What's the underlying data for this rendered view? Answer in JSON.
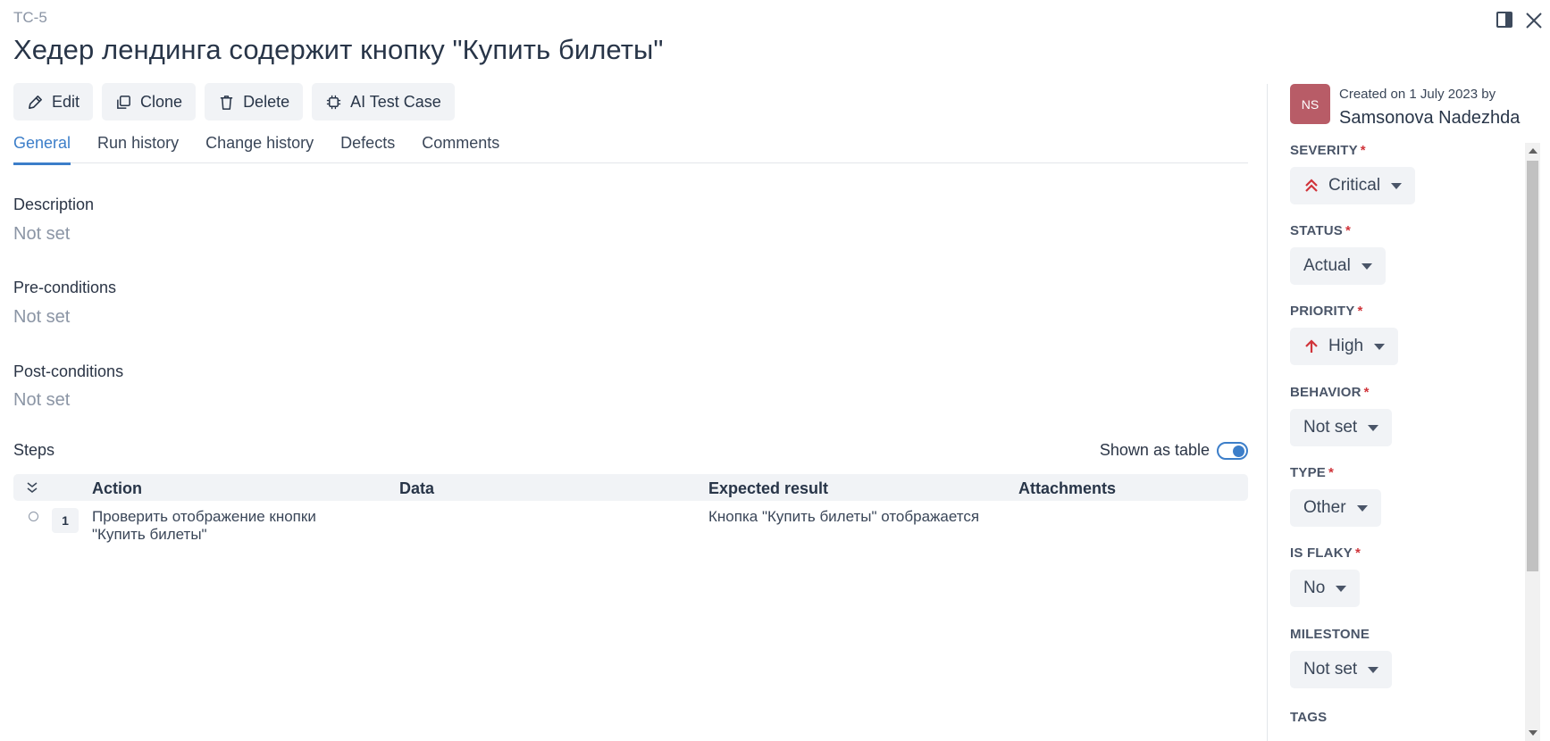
{
  "header": {
    "id": "TC-5",
    "title": "Хедер лендинга содержит кнопку \"Купить билеты\""
  },
  "toolbar": {
    "edit_label": "Edit",
    "clone_label": "Clone",
    "delete_label": "Delete",
    "ai_label": "AI Test Case"
  },
  "tabs": [
    {
      "label": "General",
      "active": true
    },
    {
      "label": "Run history"
    },
    {
      "label": "Change history"
    },
    {
      "label": "Defects"
    },
    {
      "label": "Comments"
    }
  ],
  "general": {
    "description": {
      "label": "Description",
      "value": "Not set"
    },
    "preconditions": {
      "label": "Pre-conditions",
      "value": "Not set"
    },
    "postconditions": {
      "label": "Post-conditions",
      "value": "Not set"
    },
    "steps": {
      "label": "Steps",
      "toggle_label": "Shown as table",
      "toggle_on": true,
      "columns": [
        "Action",
        "Data",
        "Expected result",
        "Attachments"
      ],
      "rows": [
        {
          "number": "1",
          "action": "Проверить отображение кнопки \"Купить билеты\"",
          "data": "",
          "expected": "Кнопка \"Купить билеты\" отображается",
          "attachments": ""
        }
      ]
    }
  },
  "sidebar": {
    "avatar_initials": "NS",
    "created_text": "Created on 1 July 2023 by",
    "author": "Samsonova Nadezhda",
    "fields": [
      {
        "label": "SEVERITY",
        "value": "Critical",
        "icon": "double-chevron-up-icon"
      },
      {
        "label": "STATUS",
        "value": "Actual"
      },
      {
        "label": "PRIORITY",
        "value": "High",
        "icon": "arrow-up-icon"
      },
      {
        "label": "BEHAVIOR",
        "value": "Not set"
      },
      {
        "label": "TYPE",
        "value": "Other"
      },
      {
        "label": "IS FLAKY",
        "value": "No"
      },
      {
        "label": "MILESTONE",
        "value": "Not set"
      },
      {
        "label": "TAGS"
      }
    ],
    "required_marker": "*"
  },
  "colors": {
    "accent": "#3c7ec9",
    "required": "#d0343a",
    "avatar": "#b85c67"
  }
}
